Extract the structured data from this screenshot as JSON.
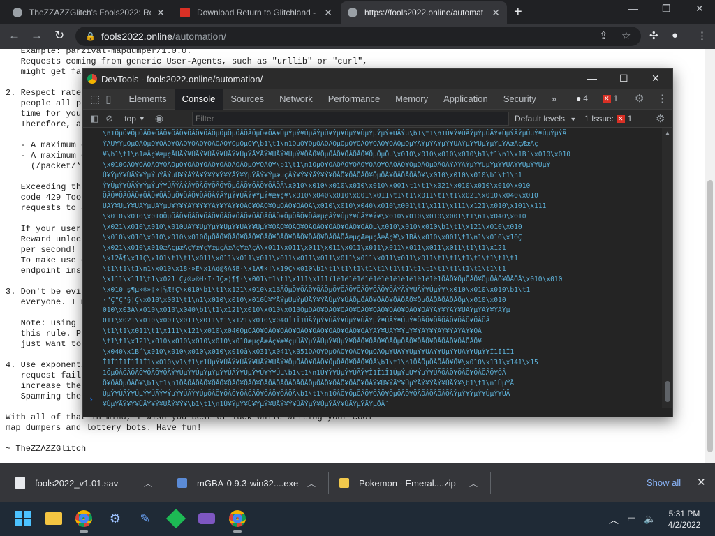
{
  "browser": {
    "tabs": [
      {
        "title": "TheZZAZZGlitch's Fools2022: Ref",
        "active": false
      },
      {
        "title": "Download Return to Glitchland -",
        "active": false
      },
      {
        "title": "https://fools2022.online/automat",
        "active": true
      }
    ],
    "address": {
      "host": "fools2022.online",
      "path": "/automation/"
    }
  },
  "page": {
    "lines": [
      "   Example: parzival-mapdumper/1.0.0.",
      "   Requests coming from generic User-Agents, such as \"urllib\" or \"curl\",",
      "   might get fa",
      "",
      "2. Respect rate",
      "   people all p",
      "   time for you",
      "   Therefore, a",
      "",
      "   - A maximum o",
      "   - A maximum o",
      "     (/packet/*",
      "",
      "   Exceeding th",
      "   code 429 Too",
      "   requests to a",
      "",
      "   If your user",
      "   Reward unlock",
      "   per second!",
      "   To make use o",
      "   endpoint inst",
      "",
      "3. Don't be evil",
      "   everyone. I m",
      "",
      "   Note: using r",
      "   this rule. Pl",
      "   just want to",
      "",
      "4. Use exponenti",
      "   request fails",
      "   increase the",
      "   Spamming the",
      "",
      "With all of that in mind, I wish you best of luck while writing your cool",
      "map dumpers and lottery bots. Have fun!",
      "",
      "~ TheZZAZZGlitch"
    ]
  },
  "devtools": {
    "title": "DevTools - fools2022.online/automation/",
    "tabs": [
      "Elements",
      "Console",
      "Sources",
      "Network",
      "Performance",
      "Memory",
      "Application",
      "Security"
    ],
    "active_tab": "Console",
    "more_tabs": "»",
    "warnings_count": "4",
    "errors_count": "1",
    "context": "top",
    "filter_placeholder": "Filter",
    "levels": "Default levels",
    "issues_label": "1 Issue:",
    "issues_count": "1",
    "prompt": "›",
    "console_lines": [
      "\\n1ÕµÕ¥ÕµÕÂÕ¥ÕÂÕ¥ÕÂÕ¥ÕÂÕ¥ÕÂÕµÕµÕµÕÂÕÂÕµÕ¥ÕÀ¥ÙµÝµÝ¥ÙµÃÝµÙ¥Ýµ¥ÙµÝ¥ÙµÝµÝµÝ¥ÙÃÝµ\\b1\\t1\\n1Ù¥Ý¥ÙÃÝµÝµÙÃÝ¥ÙµÝÃÝµÙµÝ¥ÙµÝµÝÃ",
      "ÝÃÙ¥ÝµÕµÕÂÕµÕ¥ÕÂÕ¥ÕÂÕ¥ÕÂÕ¥ÕÂÕÂÕ¥ÕµÕµÕ¥\\b1\\t1\\n1ÕµÕ¥ÕµÕÂÕÂÕµÕµÕ¥ÕÀÕ¥ÕÂÕ¥ÕÂÕµÕµÝÃÝµÝÃÝµÝ¥ÙÃÝµÝ¥ÙµÝµÝµÝÃæÂçÆæÂç",
      "¥\\b1\\t1\\n1æÂç¥æµçÂÙÃÝ¥ÙÃÝ¥ÙÃÝ¥ÙÃÝ¥ÙµÝÃÝÃÝ¥ÙÃÝ¥ÙµÝ¥ÕÂÕ¥ÕµÕÂÕ¥ÕÂÕÂÕ¥ÕµÕµÕµ\\x010\\x010\\x010\\x010\\b1\\t1\\n1\\x1B´\\x010\\x010",
      "\\x010ÕÂÕ¥ÕÂÕÂÕ¥ÕÂÕµÕ¥ÕÂÕ¥ÕÂÕ¥ÕÂÕÂÕÂÕµÕ¥ÕÂÕ¥\\b1\\t1\\n1ÕµÕ¥ÕÂÕÂÕ¥ÕÂÕ¥ÕÂÕ¥ÕÂÕÂÕ¥ÕµÕÂÕµÕÂÕÂÝÃÝÃÝµÝ¥ÙµÝµÝ¥ÙÃÝ¥ÙµÝ¥ÙµÝ",
      "Ù¥ÝµÝ¥ÙÃÝ¥ÝµÝµÝÃÝµÙ¥ÝÂÝÂ¥Ý¥Ý¥Ý¥ÝÃÝ¥ÝµÝÃÝ¥ÝµæµçÂÝ¥Ý¥ÝÃÝ¥Ý¥ÕÂÕ¥ÕÂÕÂÕ¥ÕµÕÀ¥ÕÂÕÂÕÂÕ¥\\x010\\x010\\x010\\b1\\t1\\n1",
      "Ý¥ÙµÝ¥ÙÃÝ¥ÝµÝµÝ¥ÙÃÝÂÝÂ¥ÕÂÕ¥ÕÂÕ¥ÕµÕÂÕ¥ÕÂÕ¥ÕÂÕÂ\\x010\\x010\\x010\\x010\\x010\\x001\\t1\\t1\\x021\\x010\\x010\\x010\\x010",
      "ÕÂÕ¥ÕÂÕÂÕ¥ÕÂÕ¥ÕÂÕµÕ¥ÕÂÕ¥ÕÂÕÂÝÃÝµÝ¥ÙÃÝ¥ÝµÝ¥æ¥ç¥\\x010\\x040\\x010\\x001\\x011\\t1\\t1\\x011\\t1\\t1\\x021\\x010\\x040\\x010",
      "ÙÃÝ¥ÙµÝ¥ÙÃÝµÙÃÝµÙ¥Ý¥ÝÃÝ¥Ý¥ÝÃÝ¥ÝÃÝ¥ÕÂÕ¥ÕÂÕ¥ÕµÕÂÕ¥ÕÂÕÂ\\x010\\x010\\x040\\x010\\x001\\t1\\x111\\x111\\x121\\x010\\x101\\x111",
      "\\x010\\x010\\x010ÕµÕÂÕ¥ÕÂÕ¥ÕÂÕ¥ÕÂÕ¥ÕÂÕ¥ÕÂÕÂÕÂÕ¥ÕµÕÂÕ¥ÕÂæµçÂÝ¥ÙµÝ¥ÙÃÝ¥Ý¥\\x010\\x010\\x010\\x001\\t1\\n1\\x040\\x010",
      "\\x021\\x010\\x010\\x010ÙÃÝ¥ÙµÝµÝ¥ÙµÝ¥ÙÃÝ¥ÙµÝ¥ÕÂÕ¥ÕÂÕ¥ÕÂÕÂÕ¥ÕÂÕ¥ÕÂÕ¥ÕÂÕµ\\x010\\x010\\x010\\b1\\t1\\x121\\x010\\x010",
      "\\x010\\x010\\x010\\x010\\x010ÕµÕÂÕ¥ÕÂÕ¥ÕÂÕ¥ÕÂÕ¥ÕÂÕ¥ÕÂÕ¥ÕÂÕ¥ÕÂÕÂÕÂæµçÆæµçÂæÂç¥\\x1BÂ\\x010\\x001\\t1\\n1\\x010\\x10Ç",
      "\\x021\\x010\\x010æÂçµæÂç¥æ¥ç¥æµçÂæÂç¥æÂçÂ\\x011\\x011\\x011\\x011\\x011\\x011\\x011\\x011\\x011\\x011\\t1\\t1\\x121",
      "\\x12Ã¶\\x11Ç\\x101\\t1\\t1\\x011\\x011\\x011\\x011\\x011\\x011\\x011\\x011\\x011\\x011\\x011\\x011\\t1\\t1\\t1\\t1\\t1\\t1\\t1",
      "\\t1\\t1\\t1\\n1\\x010\\x18·»Ë\\x1A¢@§A§B·\\x1A¶»¦\\x19Ç\\x010\\b1\\t1\\t1\\t1\\t1\\t1\\t1\\t1\\t1\\t1\\t1\\t1\\t1\\t1\\t1\\t1",
      "\\x111\\x111\\t1\\x021 Ç¿®»®H·I·JÇ»¦¶¶·\\x001\\t1\\t1\\x111\\x111î1ê1ê1ê1ê1ê1ê1ê1ê1ê1ê1ê1ê1ê1ÕÂÕ¥ÕµÕÂÕ¥ÕµÕÂÕ¥ÕÂÕÂ\\x010\\x010",
      "\\x010 ş¶µ»®»¦»¦¾Æ!Ç\\x010\\b1\\t1\\x121\\x010\\x1BÂÕµÕ¥ÕÂÕ¥ÕÂÕµÕ¥ÕÂÕ¥ÕÂÕ¥ÕÂÕ¥ÕÂÝÃÝ¥ÙÃÝ¥ÙµÝ¥\\x010\\x010\\x010\\b1\\t1",
      "·\"Ç\"Ç\"§¦Ç\\x010\\x001\\t1\\n1\\x010\\x010\\x010Ù¥ÝÃÝµÙµÝµÙÃÝ¥ÝÃÙµÝ¥ÙÂÕµÕÂÕ¥ÕÂÕ¥ÕÂÕÂÕ¥ÕµÕÂÕÀÕÂÕÂÕµ\\x010\\x010",
      "010\\x03Ã\\x010\\x010\\x040\\b1\\t1\\x121\\x010\\x010\\x010ÕµÕÂÕ¥ÕÂÕ¥ÕÂÕ¥ÕÂÕ¥ÕÂÕ¥ÕÂÕ¥ÕÂÕ¥ÕÂÝÃÝ¥ÝÃÝ¥ÙÃÝµÝÃÝ¥ÝÂÝµ",
      "011\\x021\\x010\\x001\\x011\\x011\\t1\\x121\\x010\\x040Î1Î1ÙÃÝµÝ¥ÙÃÝ¥ÙµÝ¥ÙÃÝµÝ¥ÙÃÝ¥ÙµÝ¥ÕÂÕ¥ÕÂÕÂÕ¥ÕÂÕ¥ÕÂÕÂ",
      "\\t1\\t1\\x011\\t1\\x111\\x121\\x010\\x040ÕµÕÂÕ¥ÕÂÕ¥ÕÂÕ¥ÕÂÕ¥ÕÂÕ¥ÕÂÕ¥ÕÂÕ¥ÕÂÝÃÝ¥ÙÃÝ¥ÝµÝ¥ÝÃÝ¥ÝÃÝ¥ÝÃÝÃÝ¥ÕÂ",
      "\\t1\\t1\\x121\\x010\\x010\\x010\\x010\\x010æµçÂæÂç¥æ¥çµÙÃÝµÝÃÙµÝ¥ÙµÝ¥ÕÂÕ¥ÕÂÕ¥ÕÂÕµÕÂÕ¥ÕÂÕ¥ÕÂÕÂÕ¥ÕÂÕÂÕ¥",
      "\\x040\\x1B´\\x010\\x010\\x010\\x010\\x010à\\x031\\x041\\x051ÕÂÕ¥ÕµÕÂÕ¥ÕÂÕ¥ÕµÕÂÕµ¥ÙÃÝ¥ÙµÝ¥ÙÃÝ¥ÙµÝ¥ÙÃÝ¥ÙµÝ¥Î1Î1Î1",
      "Î1Î1Î1Î1Î1Î1\\x010\\v1\\f1\\r1ÙµÝ¥ÙÃÝ¥ÙÃÝ¥ÙÃÝ¥ÙÃÝ¥ÕµÕÂÕ¥ÕÂÕ¥ÕµÕÂÕ¥ÕÂÕ¥ÕÂ\\b1\\t1\\n1ÕÂÕµÕÂÕÂÕ¥Õ¥\\x010\\x131\\x141\\x15",
      "1ÕµÕÂÕÂÕÂÕ¥ÕÂÕ¥ÕÂÝ¥ÙµÝ¥ÙµÝµÝµÝ¥ÙÃÝ¥ÙµÝ¥Ù¥Ý¥Ùµ\\b1\\t1\\n1Ù¥Ý¥ÙµÝ¥ÙÃÝ¥Î1Î1Î1ÙµÝµÙ¥ÝµÝ¥ÙÃÕÂÕ¥ÕÂÕ¥ÕÂÕÂÕ¥ÕÂ",
      "Õ¥ÕÂÕµÕÂÕ¥\\b1\\t1\\n1ÕÂÕÂÕÂÕ¥ÕÂÕ¥ÕÂÕ¥ÕÂÕ¥ÕÂÕÂÕÂÕÂÕÂÕÂÕµÕÂÕ¥ÕÂÕ¥ÕÂÕ¥ÕÂÝ¥Ù¥ÝÃÝ¥ÙµÝÃÝ¥ÝÃÝ¥ÙÃÝ¥\\b1\\t1\\n1ÙµÝÃ",
      "ÙµÝ¥ÙÃÝ¥ÙµÝ¥ÙÃÝ¥ÝµÝ¥ÙÃÝ¥ÙµÕÂÕ¥ÕÂÕ¥ÕÂÕÂÕ¥ÕÂÕ¥ÕÂÕÂ\\b1\\t1\\n1ÕÂÕ¥ÕµÕÂÕ¥ÕÂÕ¥ÕµÕÂÕ¥ÕÂÕÂÕÂÕÂÕÂÝµÝ¥ÝµÝ¥ÙµÝ¥ÙÃ",
      "¥ÙµÝÃÝ¥Ý¥ÙÃÝ¥Ý¥ÙÃÝ¥Ý¥\\b1\\t1\\n1Ù¥ÝµÝ¥Ù¥ÝµÝ¥ÙÃÝ¥Ý¥ÙÃÝµÝ¥ÙµÝÃÝ¥ÙÃÝµÝÃÝµÕÂ`"
    ]
  },
  "downloads": [
    {
      "name": "fools2022_v1.01.sav",
      "icon": "file-icon"
    },
    {
      "name": "mGBA-0.9.3-win32....exe",
      "icon": "exe-icon"
    },
    {
      "name": "Pokemon - Emeral....zip",
      "icon": "zip-icon"
    }
  ],
  "downloads_show_all": "Show all",
  "taskbar": {
    "time": "5:31 PM",
    "date": "4/2/2022"
  },
  "colors": {
    "console_text": "#5db0d7",
    "accent": "#1a73e8"
  }
}
